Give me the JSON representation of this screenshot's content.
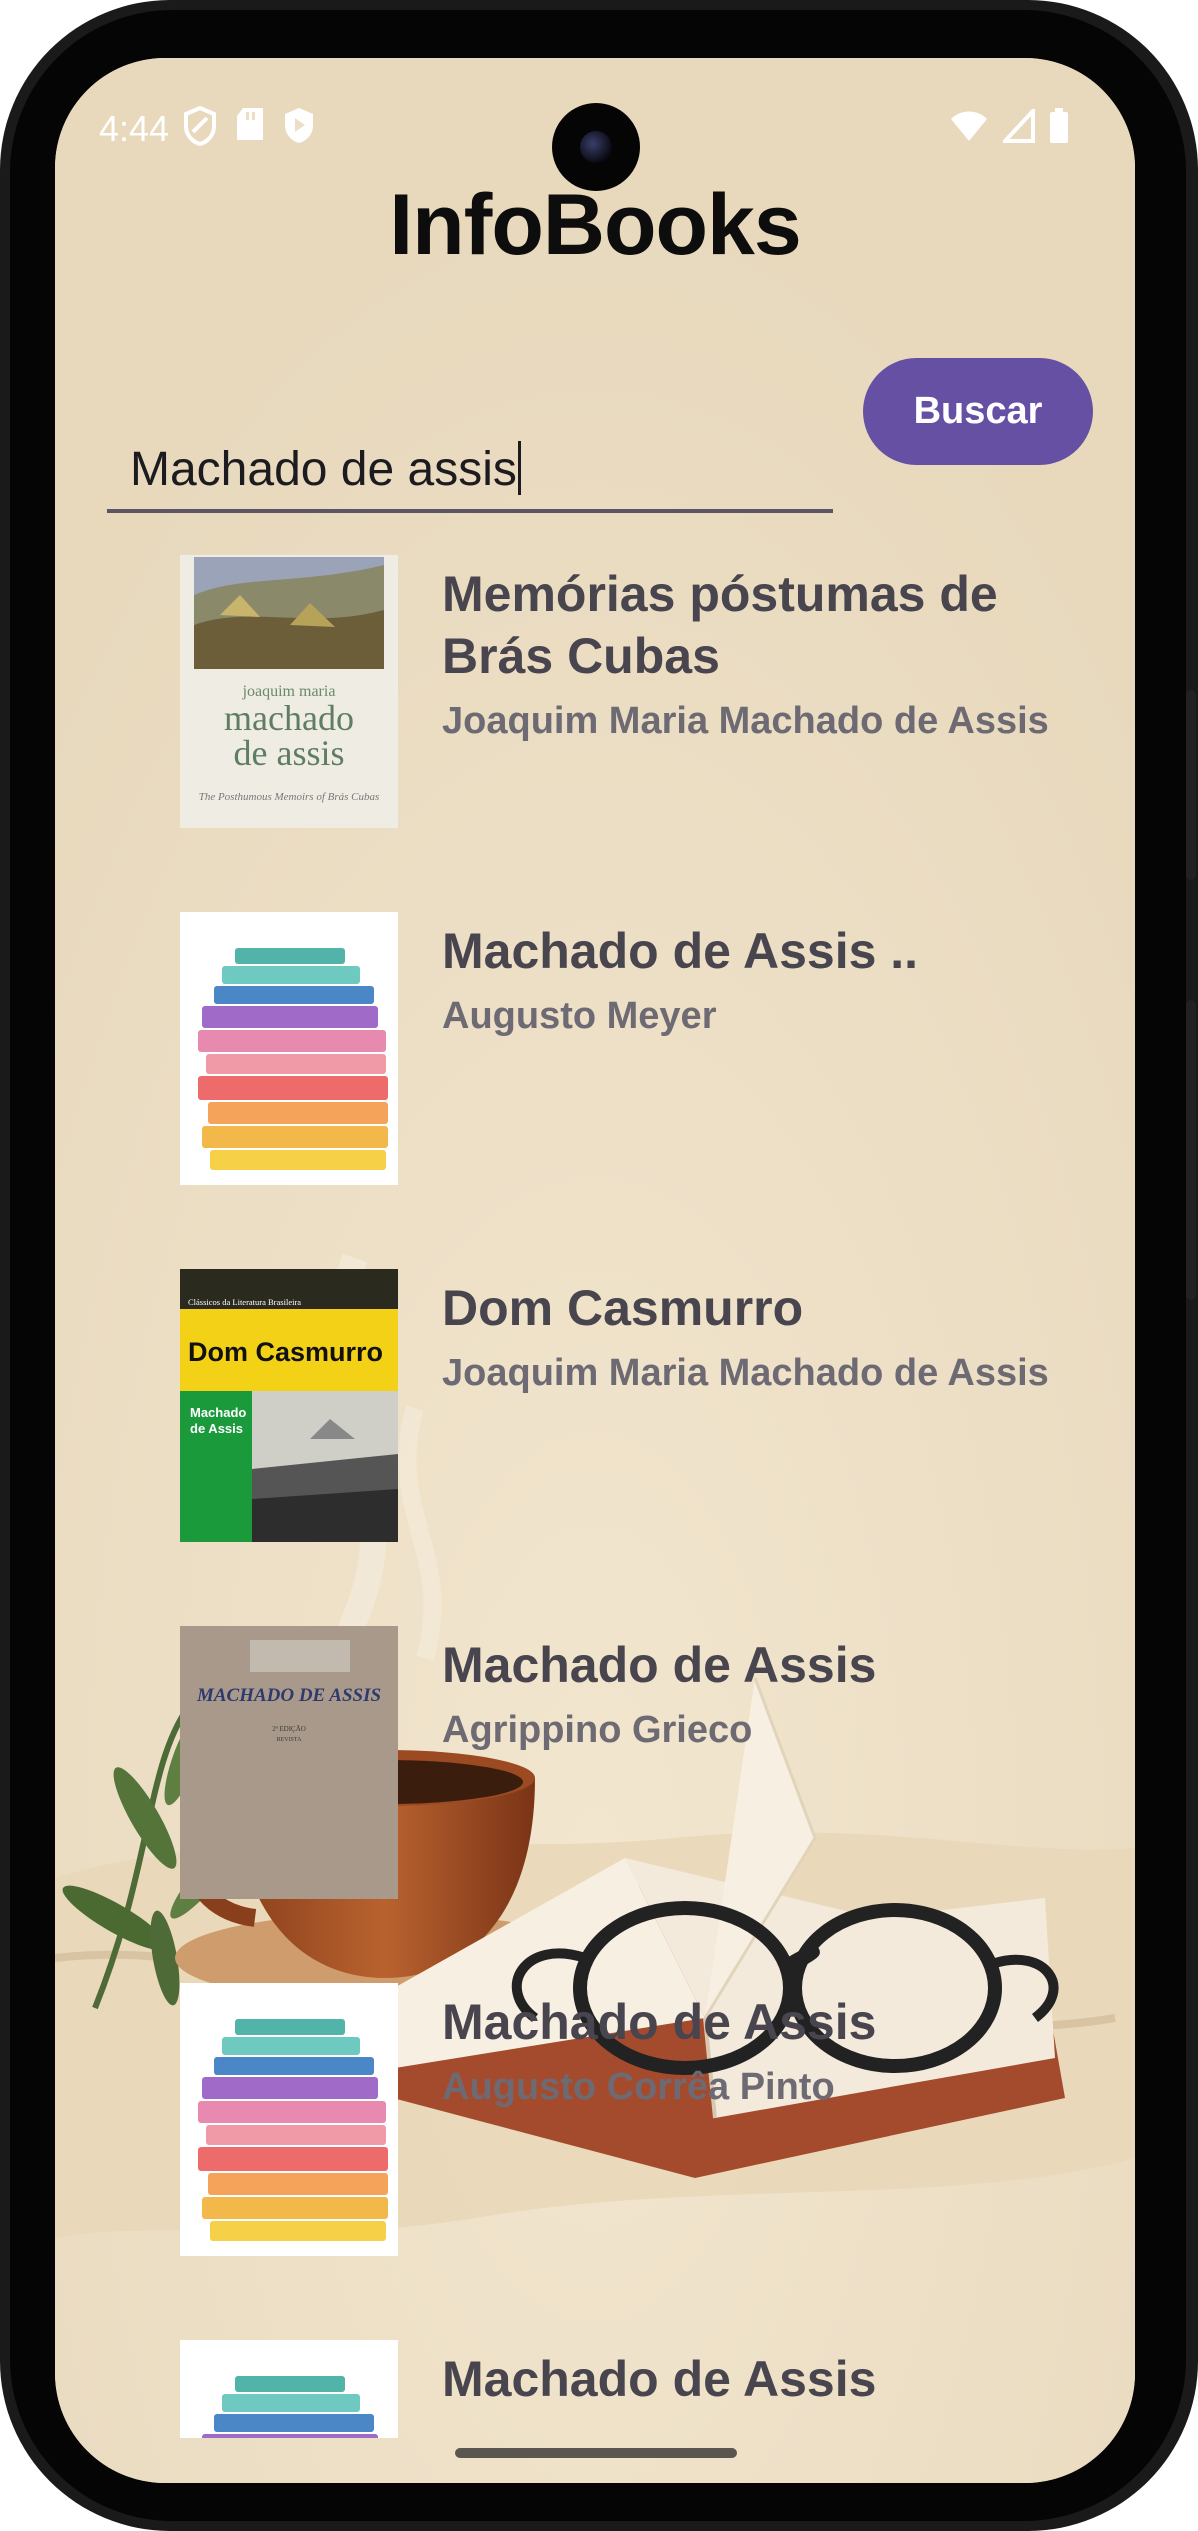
{
  "status_bar": {
    "time": "4:44",
    "left_icons": [
      "shield-icon",
      "sd-card-icon",
      "play-protect-icon"
    ],
    "right_icons": [
      "wifi-icon",
      "signal-icon",
      "battery-icon"
    ]
  },
  "app": {
    "title": "InfoBooks"
  },
  "search": {
    "value": "Machado de assis",
    "button_label": "Buscar"
  },
  "books": [
    {
      "title": "Memórias póstumas de Brás Cubas",
      "author": "Joaquim Maria Machado de Assis",
      "cover": "painting-cover"
    },
    {
      "title": "Machado de Assis ..",
      "author": "Augusto Meyer",
      "cover": "book-stack-placeholder"
    },
    {
      "title": "Dom Casmurro",
      "author": "Joaquim Maria Machado de Assis",
      "cover": "dom-casmurro-cover",
      "cover_text": {
        "series": "Clássicos da Literatura Brasileira",
        "title": "Dom Casmurro",
        "author_line1": "Machado",
        "author_line2": "de Assis"
      }
    },
    {
      "title": "Machado de Assis",
      "author": "Agrippino Grieco",
      "cover": "old-paper-cover",
      "cover_text": {
        "title": "MACHADO DE ASSIS",
        "edition": "2ª EDIÇÃO",
        "revised": "REVISTA"
      }
    },
    {
      "title": "Machado de Assis",
      "author": "Augusto Corrêa Pinto",
      "cover": "book-stack-placeholder"
    },
    {
      "title": "Machado de Assis",
      "author": "",
      "cover": "book-stack-placeholder"
    }
  ],
  "cover1_text": {
    "line1": "joaquim maria",
    "line2": "machado",
    "line3": "de assis",
    "line4": "The Posthumous Memoirs of Brás Cubas"
  },
  "colors": {
    "background": "#ecdfc5",
    "accent": "#6650a4",
    "title_text": "#48454f",
    "author_text": "#6e6a74"
  }
}
